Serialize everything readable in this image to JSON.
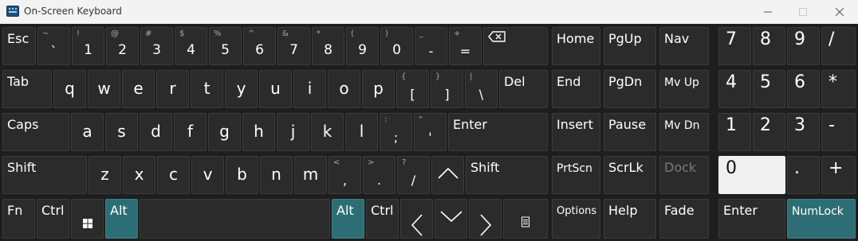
{
  "window": {
    "title": "On-Screen Keyboard",
    "icon": "keyboard-app-icon",
    "controls": [
      "minimize-icon",
      "maximize-icon",
      "close-icon"
    ]
  },
  "colors": {
    "titlebar": "#f3f3f3",
    "keyboard_bg": "#1e1e1e",
    "key": "#2b2b2b",
    "active_key": "#2d6e75",
    "pressed_key": "#f0f0f0",
    "disabled_text": "#7a7a7a"
  },
  "rows": {
    "row1": {
      "esc": "Esc",
      "tilde": [
        "~",
        "`"
      ],
      "k1": [
        "!",
        "1"
      ],
      "k2": [
        "@",
        "2"
      ],
      "k3": [
        "#",
        "3"
      ],
      "k4": [
        "$",
        "4"
      ],
      "k5": [
        "%",
        "5"
      ],
      "k6": [
        "^",
        "6"
      ],
      "k7": [
        "&",
        "7"
      ],
      "k8": [
        "*",
        "8"
      ],
      "k9": [
        "(",
        "9"
      ],
      "k0": [
        ")",
        "0"
      ],
      "minus": [
        "_",
        "-"
      ],
      "equal": [
        "+",
        "="
      ],
      "backspace_icon": "backspace-icon"
    },
    "row2": {
      "tab": "Tab",
      "letters": [
        "q",
        "w",
        "e",
        "r",
        "t",
        "y",
        "u",
        "i",
        "o",
        "p"
      ],
      "lbracket": [
        "{",
        "["
      ],
      "rbracket": [
        "}",
        "]"
      ],
      "pipe": [
        "|",
        "\\"
      ],
      "del": "Del"
    },
    "row3": {
      "caps": "Caps",
      "letters": [
        "a",
        "s",
        "d",
        "f",
        "g",
        "h",
        "j",
        "k",
        "l"
      ],
      "semicolon": [
        ":",
        ";"
      ],
      "quote": [
        "\"",
        "'"
      ],
      "enter": "Enter"
    },
    "row4": {
      "shift_left": "Shift",
      "letters": [
        "z",
        "x",
        "c",
        "v",
        "b",
        "n",
        "m"
      ],
      "comma": [
        "<",
        ","
      ],
      "period": [
        ">",
        "."
      ],
      "slash": [
        "?",
        "/"
      ],
      "up_icon": "chevron-up-icon",
      "shift_right": "Shift"
    },
    "row5": {
      "fn": "Fn",
      "ctrl_left": "Ctrl",
      "win_icon": "windows-icon",
      "alt_left": "Alt",
      "alt_right": "Alt",
      "ctrl_right": "Ctrl",
      "left_icon": "chevron-left-icon",
      "down_icon": "chevron-down-icon",
      "right_icon": "chevron-right-icon",
      "menu_icon": "menu-icon"
    }
  },
  "nav": {
    "home": "Home",
    "pgup": "PgUp",
    "nav": "Nav",
    "end": "End",
    "pgdn": "PgDn",
    "mvup": "Mv Up",
    "insert": "Insert",
    "pause": "Pause",
    "mvdn": "Mv Dn",
    "prtscn": "PrtScn",
    "scrlk": "ScrLk",
    "dock": "Dock",
    "options": "Options",
    "help": "Help",
    "fade": "Fade"
  },
  "numpad": {
    "n7": "7",
    "n8": "8",
    "n9": "9",
    "div": "/",
    "n4": "4",
    "n5": "5",
    "n6": "6",
    "mul": "*",
    "n1": "1",
    "n2": "2",
    "n3": "3",
    "sub": "-",
    "n0": "0",
    "dot": ".",
    "add": "+",
    "enter": "Enter",
    "numlock": "NumLock"
  }
}
